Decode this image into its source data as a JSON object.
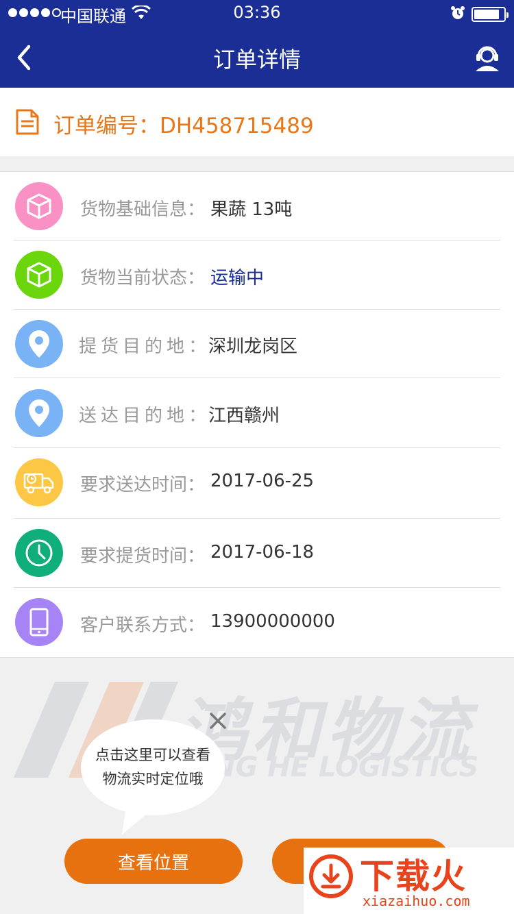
{
  "status_bar": {
    "carrier": "中国联通",
    "time": "03:36"
  },
  "nav": {
    "title": "订单详情"
  },
  "order": {
    "text": "订单编号：DH458715489"
  },
  "rows": [
    {
      "label": "货物基础信息：",
      "value": "果蔬  13吨",
      "color": "#fa91c4",
      "icon": "box-icon"
    },
    {
      "label": "货物当前状态：",
      "value": "运输中",
      "color": "#6cd60c",
      "icon": "box-icon",
      "value_color": "#1a2e96"
    },
    {
      "label": "提货目的地：",
      "value": "深圳龙岗区",
      "color": "#7ab3f5",
      "icon": "location-pin-icon"
    },
    {
      "label": "送达目的地：",
      "value": "江西赣州",
      "color": "#7ab3f5",
      "icon": "location-pin-icon"
    },
    {
      "label": "要求送达时间：",
      "value": "2017-06-25",
      "color": "#fbc744",
      "icon": "delivery-truck-icon"
    },
    {
      "label": "要求提货时间：",
      "value": "2017-06-18",
      "color": "#0fae7a",
      "icon": "clock-icon"
    },
    {
      "label": "客户联系方式：",
      "value": "13900000000",
      "color": "#a784f5",
      "icon": "phone-icon"
    }
  ],
  "watermark": {
    "cn": "鸿和物流",
    "en": "NG HE LOGISTICS"
  },
  "tooltip": {
    "line1": "点击这里可以查看",
    "line2": "物流实时定位哦"
  },
  "buttons": {
    "view_location": "查看位置"
  },
  "logo": {
    "text": "下载火",
    "url": "xiazaihuo.com"
  }
}
